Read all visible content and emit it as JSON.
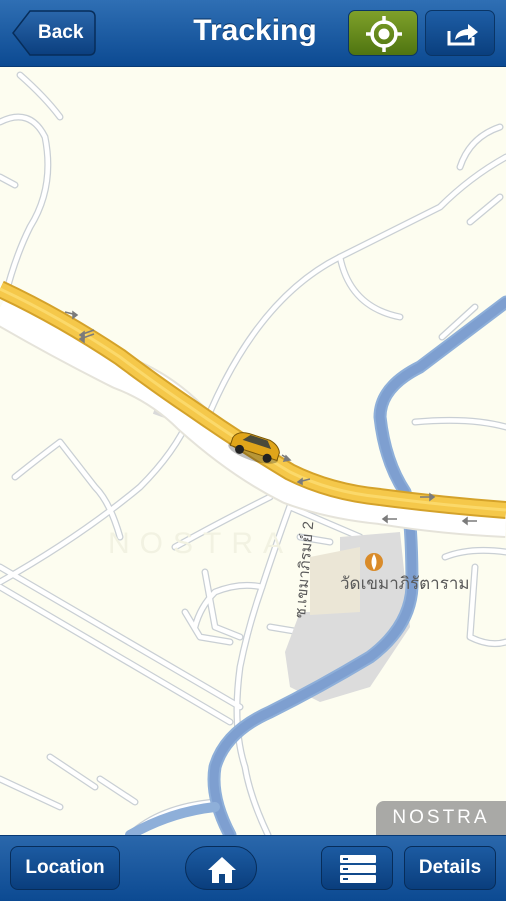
{
  "header": {
    "title": "Tracking",
    "back_label": "Back",
    "locate_icon": "crosshair-icon",
    "share_icon": "share-icon",
    "accent_locate": "#6a8f1f"
  },
  "map": {
    "place_label": "วัดเขมาภิรัตาราม",
    "road_label": "ซ.เขมาภิรมย์ 2",
    "watermark": "NOSTRA",
    "provider": "NOSTRA",
    "vehicle_icon": "car-icon",
    "poi_icon": "temple-icon"
  },
  "footer": {
    "location_label": "Location",
    "home_icon": "home-icon",
    "menu_icon": "list-icon",
    "details_label": "Details"
  }
}
